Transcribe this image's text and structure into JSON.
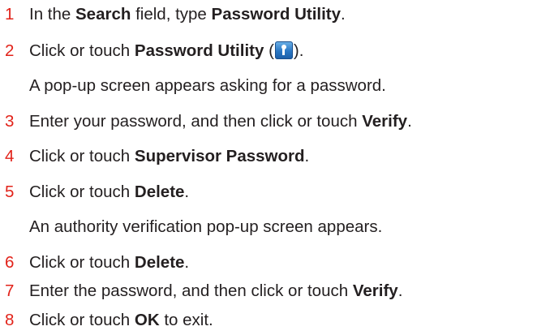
{
  "steps": [
    {
      "num": "1",
      "parts": [
        "In the ",
        "Search",
        " field, type ",
        "Password Utility",
        "."
      ]
    },
    {
      "num": "2",
      "parts": [
        "Click or touch ",
        "Password Utility",
        " (",
        ")."
      ]
    },
    {
      "note": "A pop-up screen appears asking for a password."
    },
    {
      "num": "3",
      "parts": [
        "Enter your password, and then click or touch ",
        "Verify",
        "."
      ]
    },
    {
      "num": "4",
      "parts": [
        "Click or touch ",
        "Supervisor Password",
        "."
      ]
    },
    {
      "num": "5",
      "parts": [
        "Click or touch ",
        "Delete",
        "."
      ]
    },
    {
      "note": "An authority verification pop-up screen appears."
    },
    {
      "num": "6",
      "parts": [
        "Click or touch ",
        "Delete",
        "."
      ]
    },
    {
      "num": "7",
      "parts": [
        "Enter the password, and then click or touch ",
        "Verify",
        "."
      ]
    },
    {
      "num": "8",
      "parts": [
        "Click or touch ",
        "OK",
        " to exit."
      ]
    }
  ],
  "icons": {
    "password_utility": "password-utility-app-icon"
  },
  "colors": {
    "step_number": "#e2231a",
    "text": "#231f20"
  }
}
